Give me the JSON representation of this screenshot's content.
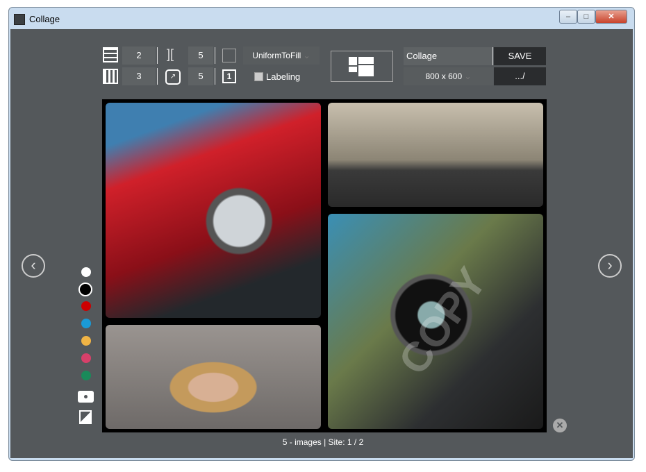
{
  "window": {
    "title": "Collage",
    "min": "–",
    "max": "□",
    "close": "✕"
  },
  "toolbar": {
    "rows": "2",
    "cols": "3",
    "spacing": "5",
    "corner_radius": "5",
    "fill_mode": "UniformToFill",
    "labeling_label": "Labeling",
    "labeling_checked": false,
    "page_icon_label": "1",
    "name": "Collage",
    "save_label": "SAVE",
    "size": "800 x 600",
    "path_label": ".../"
  },
  "colors": [
    "#ffffff",
    "#000000",
    "#cc0000",
    "#1a9ad6",
    "#f0b445",
    "#d8406a",
    "#1a8a5a"
  ],
  "status": "5 - images | Site: 1 / 2",
  "watermark": "COPY"
}
